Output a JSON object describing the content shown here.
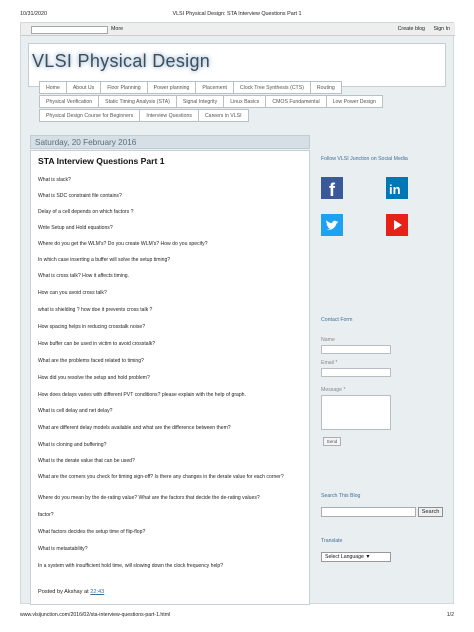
{
  "print": {
    "date": "10/31/2020",
    "title": "VLSI Physical Design: STA Interview Questions Part 1",
    "url": "www.vlsijunction.com/2016/02/sta-interview-questions-part-1.html",
    "page": "1/2"
  },
  "navbar": {
    "more": "More",
    "create_blog": "Create blog",
    "sign_in": "Sign In"
  },
  "header": {
    "blog_title": "VLSI Physical Design"
  },
  "tabs": {
    "row1": [
      "Home",
      "About Us",
      "Floor Planning",
      "Power planning",
      "Placement",
      "Clock Tree Synthesis (CTS)",
      "Routing"
    ],
    "row2": [
      "Physical Verification",
      "Static Timing Analysis (STA)",
      "Signal Integrity",
      "Linux Basics",
      "CMOS Fundamental",
      "Low Power Design"
    ],
    "row3": [
      "Physical Design Course for Beginners",
      "Interview Questions",
      "Careers in VLSI"
    ]
  },
  "post": {
    "date_header": "Saturday, 20 February 2016",
    "title": "STA Interview Questions Part 1",
    "questions": [
      "What is slack?",
      "What is SDC constraint file contains?",
      "Delay of a cell depends on which factors ?",
      "Write Setup and Hold equations?",
      "Where do you get the WLM's? Do you create WLM's? How do you specify?",
      "In which case inserting a buffer will solve the setup timing?",
      "What is cross talk? How it affects timing.",
      "How can you avoid cross talk?",
      "what is  shielding ? how doe it prevents  cross talk ?",
      "How spacing helps in reducing crosstalk noise?",
      "How buffer can be used in victim to avoid crosstalk?",
      "What are the problems faced related to timing?",
      "How did you resolve the setup and hold problem?",
      "How does delays varies with different PVT conditions? please explain with the help of graph.",
      "What is cell delay and net delay?",
      "What are different delay models  available and what are the difference between them?",
      "What is cloning and buffering?",
      "What is the derate value that can be used?",
      "What are the corners you check for timing sign-off? Is there any changes in the derate value for each corner?",
      "Where do you mean by the de-rating value? What are the factors that decide the de-rating values?",
      "factor?",
      "What factors decides the setup time of flip-flop?",
      "What is metastability?",
      "In a system with insufficient hold time, will slowing down the clock frequency help?"
    ],
    "posted_by_prefix": "Posted by Akshay at ",
    "posted_time": "22:43"
  },
  "sidebar": {
    "follow_title": "Follow VLSI Junction on Social Media",
    "social": [
      {
        "icon": "facebook-icon",
        "color": "#3b5998",
        "glyph": "f"
      },
      {
        "icon": "linkedin-icon",
        "color": "#0077b5",
        "glyph": "in"
      },
      {
        "icon": "twitter-icon",
        "color": "#1da1f2",
        "glyph": ""
      },
      {
        "icon": "youtube-icon",
        "color": "#e62117",
        "glyph": ""
      }
    ],
    "contact": {
      "title": "Contact Form",
      "name_label": "Name",
      "email_label": "Email *",
      "message_label": "Message *",
      "send_label": "Send"
    },
    "search": {
      "title": "Search This Blog",
      "button": "Search"
    },
    "translate": {
      "title": "Translate",
      "select_label": "Select Language"
    }
  }
}
